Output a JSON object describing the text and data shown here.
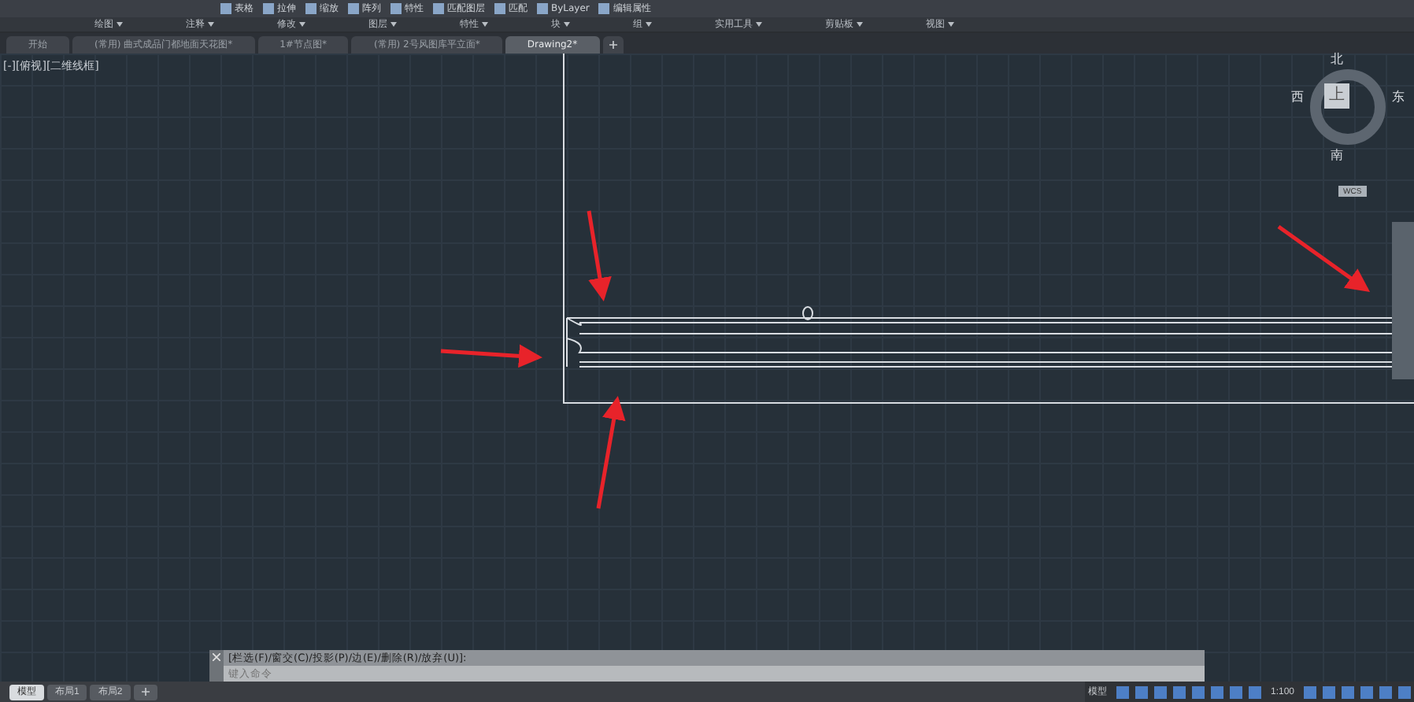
{
  "ribbon": {
    "tools": [
      {
        "label": "表格"
      },
      {
        "label": "拉伸"
      },
      {
        "label": "缩放"
      },
      {
        "label": "阵列"
      },
      {
        "label": "特性"
      },
      {
        "label": "匹配图层"
      },
      {
        "label": "匹配"
      },
      {
        "label": "ByLayer"
      },
      {
        "label": "编辑属性"
      }
    ],
    "panels": [
      "绘图",
      "注释",
      "修改",
      "图层",
      "特性",
      "块",
      "组",
      "实用工具",
      "剪贴板",
      "视图"
    ]
  },
  "file_tabs": [
    {
      "label": "开始",
      "selected": false
    },
    {
      "label": "(常用) 曲式成品门都地面天花图*",
      "selected": false
    },
    {
      "label": "1#节点图*",
      "selected": false
    },
    {
      "label": "(常用) 2号风图库平立面*",
      "selected": false
    },
    {
      "label": "Drawing2*",
      "selected": true
    }
  ],
  "viewport": {
    "label": "[-][俯视][二维线框]",
    "compass": {
      "north": "北",
      "south": "南",
      "east": "东",
      "west": "西",
      "top": "上",
      "ucs": "WCS"
    }
  },
  "command_line": {
    "history": "[栏选(F)/窗交(C)/投影(P)/边(E)/删除(R)/放弃(U)]:",
    "placeholder": "键入命令"
  },
  "layout_tabs": [
    {
      "label": "模型",
      "selected": true
    },
    {
      "label": "布局1",
      "selected": false
    },
    {
      "label": "布局2",
      "selected": false
    }
  ],
  "status_bar": {
    "model": "模型",
    "scale": "1:100"
  }
}
